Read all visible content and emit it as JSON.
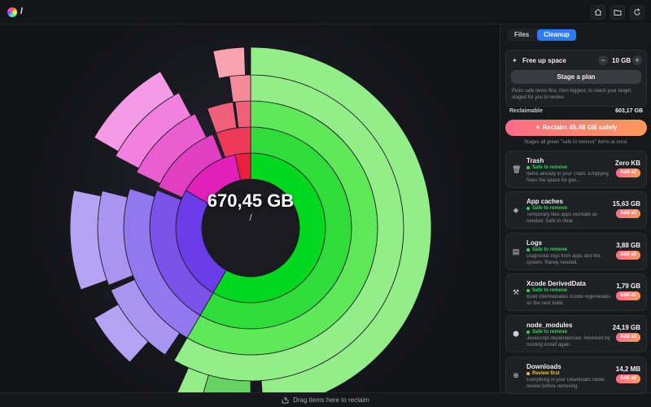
{
  "titlebar": {
    "path": "/"
  },
  "main": {
    "total_size": "670,45 GB",
    "center_path": "/",
    "colors": {
      "green": "#00d820",
      "purple": "#6a3de8",
      "magenta": "#e11fb9",
      "red": "#e8203c"
    }
  },
  "footer": {
    "drop_hint": "Drag items here to reclaim"
  },
  "sidebar": {
    "tabs": [
      {
        "label": "Files"
      },
      {
        "label": "Cleanup"
      }
    ],
    "free_up": {
      "label": "Free up space",
      "value": "10 GB",
      "stage_button": "Stage a plan",
      "description": "Picks safe items first, then biggest, to reach your target, staged for you to review."
    },
    "reclaimable": {
      "label": "Reclaimable",
      "value": "603,17 GB"
    },
    "reclaim_button": "Reclaim 45,48 GB safely",
    "reclaim_note": "Stages all green \"safe to remove\" items at once.",
    "items": [
      {
        "title": "Trash",
        "status": "Safe to remove",
        "status_color": "#2bd45a",
        "description": "Items already in your Trash. Emptying frees the space for goo…",
        "size": "Zero KB",
        "action": "Add all",
        "icon": "trash-icon"
      },
      {
        "title": "App caches",
        "status": "Safe to remove",
        "status_color": "#2bd45a",
        "description": "Temporary files apps recreate as needed. Safe to clear.",
        "size": "15,63 GB",
        "action": "Add all",
        "icon": "cube-icon"
      },
      {
        "title": "Logs",
        "status": "Safe to remove",
        "status_color": "#2bd45a",
        "description": "Diagnostic logs from apps and the system. Rarely needed.",
        "size": "3,88 GB",
        "action": "Add all",
        "icon": "document-icon"
      },
      {
        "title": "Xcode DerivedData",
        "status": "Safe to remove",
        "status_color": "#2bd45a",
        "description": "Build intermediates Xcode regenerates on the next build.",
        "size": "1,79 GB",
        "action": "Add all",
        "icon": "hammer-icon"
      },
      {
        "title": "node_modules",
        "status": "Safe to remove",
        "status_color": "#2bd45a",
        "description": "JavaScript dependencies. Restored by running install again.",
        "size": "24,19 GB",
        "action": "Add all",
        "icon": "package-icon"
      },
      {
        "title": "Downloads",
        "status": "Review first",
        "status_color": "#f2c230",
        "description": "Everything in your Downloads folder, review before removing.",
        "size": "14,2 MB",
        "action": "Add all",
        "icon": "download-icon"
      }
    ]
  }
}
